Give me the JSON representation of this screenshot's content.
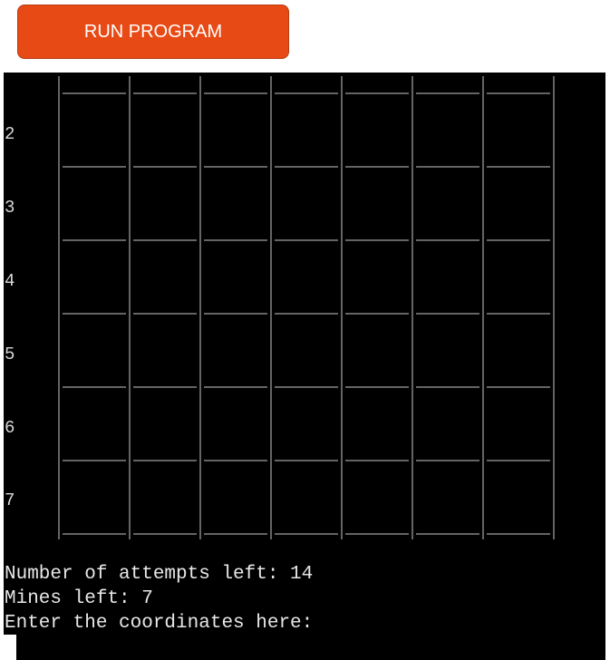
{
  "toolbar": {
    "run_label": "RUN PROGRAM",
    "run_color": "#e84a16"
  },
  "terminal": {
    "background": "#000000",
    "text_color": "#e8e8e8",
    "row_labels": [
      "2",
      "3",
      "4",
      "5",
      "6",
      "7"
    ],
    "columns": 7,
    "attempts_line": "Number of attempts left: 14",
    "mines_line": "Mines left: 7",
    "prompt_line": "Enter the coordinates here:",
    "input_value": ""
  }
}
